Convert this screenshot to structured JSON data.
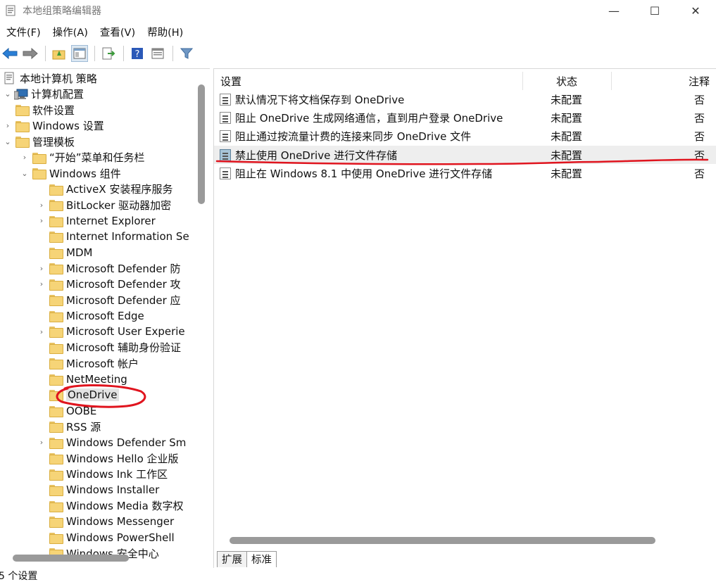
{
  "window": {
    "title": "本地组策略编辑器",
    "min_glyph": "—",
    "max_glyph": "☐",
    "close_glyph": "✕"
  },
  "menu": [
    "文件(F)",
    "操作(A)",
    "查看(V)",
    "帮助(H)"
  ],
  "tree": [
    {
      "label": "本地计算机 策略",
      "level": 0,
      "chevron": "",
      "icon": "policy-icon"
    },
    {
      "label": "计算机配置",
      "level": 0,
      "chevron": "⌄",
      "icon": "computer-icon"
    },
    {
      "label": "软件设置",
      "level": 1,
      "chevron": ""
    },
    {
      "label": "Windows 设置",
      "level": 1,
      "chevron": "›"
    },
    {
      "label": "管理模板",
      "level": 1,
      "chevron": "⌄"
    },
    {
      "label": "“开始”菜单和任务栏",
      "level": 2,
      "chevron": "›"
    },
    {
      "label": "Windows 组件",
      "level": 2,
      "chevron": "⌄"
    },
    {
      "label": "ActiveX 安装程序服务",
      "level": 3,
      "chevron": ""
    },
    {
      "label": "BitLocker 驱动器加密",
      "level": 3,
      "chevron": "›"
    },
    {
      "label": "Internet Explorer",
      "level": 3,
      "chevron": "›"
    },
    {
      "label": "Internet Information Se",
      "level": 3,
      "chevron": ""
    },
    {
      "label": "MDM",
      "level": 3,
      "chevron": ""
    },
    {
      "label": "Microsoft Defender 防",
      "level": 3,
      "chevron": "›"
    },
    {
      "label": "Microsoft Defender 攻",
      "level": 3,
      "chevron": "›"
    },
    {
      "label": "Microsoft Defender 应",
      "level": 3,
      "chevron": ""
    },
    {
      "label": "Microsoft Edge",
      "level": 3,
      "chevron": ""
    },
    {
      "label": "Microsoft User Experie",
      "level": 3,
      "chevron": "›"
    },
    {
      "label": "Microsoft 辅助身份验证",
      "level": 3,
      "chevron": ""
    },
    {
      "label": "Microsoft 帐户",
      "level": 3,
      "chevron": ""
    },
    {
      "label": "NetMeeting",
      "level": 3,
      "chevron": ""
    },
    {
      "label": "OneDrive",
      "level": 3,
      "chevron": "",
      "selected": true
    },
    {
      "label": "OOBE",
      "level": 3,
      "chevron": ""
    },
    {
      "label": "RSS 源",
      "level": 3,
      "chevron": ""
    },
    {
      "label": "Windows Defender Sm",
      "level": 3,
      "chevron": "›"
    },
    {
      "label": "Windows Hello 企业版",
      "level": 3,
      "chevron": ""
    },
    {
      "label": "Windows Ink 工作区",
      "level": 3,
      "chevron": ""
    },
    {
      "label": "Windows Installer",
      "level": 3,
      "chevron": ""
    },
    {
      "label": "Windows Media 数字权",
      "level": 3,
      "chevron": ""
    },
    {
      "label": "Windows Messenger",
      "level": 3,
      "chevron": ""
    },
    {
      "label": "Windows PowerShell",
      "level": 3,
      "chevron": ""
    },
    {
      "label": "Windows 安全中心",
      "level": 3,
      "chevron": ""
    }
  ],
  "list": {
    "headers": {
      "setting": "设置",
      "state": "状态",
      "note": "注释"
    },
    "rows": [
      {
        "name": "默认情况下将文档保存到 OneDrive",
        "state": "未配置",
        "note": "否",
        "icon": "policy-setting-icon"
      },
      {
        "name": "阻止 OneDrive 生成网络通信，直到用户登录 OneDrive",
        "state": "未配置",
        "note": "否",
        "icon": "policy-setting-download-icon"
      },
      {
        "name": "阻止通过按流量计费的连接来同步 OneDrive 文件",
        "state": "未配置",
        "note": "否",
        "icon": "policy-setting-icon"
      },
      {
        "name": "禁止使用 OneDrive 进行文件存储",
        "state": "未配置",
        "note": "否",
        "icon": "policy-setting-selected-icon",
        "highlight": true
      },
      {
        "name": "阻止在 Windows 8.1 中使用 OneDrive 进行文件存储",
        "state": "未配置",
        "note": "否",
        "icon": "policy-setting-icon"
      }
    ]
  },
  "tabs": [
    "扩展",
    "标准"
  ],
  "status": "5 个设置",
  "colors": {
    "annotation": "#e0141e",
    "folder": "#f6d477",
    "highlight": "#eeeeee"
  }
}
